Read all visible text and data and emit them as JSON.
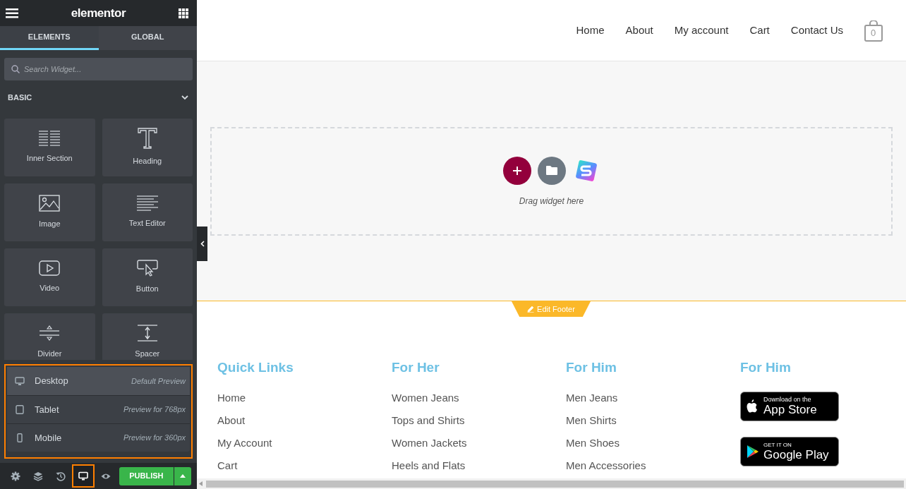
{
  "panel": {
    "title": "elementor",
    "tabs": [
      {
        "label": "ELEMENTS",
        "selected": true
      },
      {
        "label": "GLOBAL",
        "selected": false
      }
    ],
    "search": {
      "placeholder": "Search Widget..."
    },
    "category": {
      "label": "BASIC",
      "expanded": true
    },
    "widgets": [
      {
        "kind": "inner-section",
        "label": "Inner Section"
      },
      {
        "kind": "heading",
        "label": "Heading"
      },
      {
        "kind": "image",
        "label": "Image"
      },
      {
        "kind": "text-editor",
        "label": "Text Editor"
      },
      {
        "kind": "video",
        "label": "Video"
      },
      {
        "kind": "button",
        "label": "Button"
      },
      {
        "kind": "divider",
        "label": "Divider"
      },
      {
        "kind": "spacer",
        "label": "Spacer"
      }
    ],
    "devices": [
      {
        "kind": "desktop",
        "label": "Desktop",
        "hint": "Default Preview",
        "selected": true
      },
      {
        "kind": "tablet",
        "label": "Tablet",
        "hint": "Preview for 768px",
        "selected": false
      },
      {
        "kind": "mobile",
        "label": "Mobile",
        "hint": "Preview for 360px",
        "selected": false
      }
    ],
    "tools": [
      {
        "kind": "settings",
        "selected": false
      },
      {
        "kind": "navigator",
        "selected": false
      },
      {
        "kind": "history",
        "selected": false
      },
      {
        "kind": "responsive",
        "selected": true
      },
      {
        "kind": "preview",
        "selected": false
      }
    ],
    "publish": "PUBLISH"
  },
  "site": {
    "nav": [
      "Home",
      "About",
      "My account",
      "Cart",
      "Contact Us"
    ],
    "cart_count": "0",
    "drop_zone": {
      "hint": "Drag widget here"
    },
    "edit_footer": "Edit Footer",
    "footer_columns": [
      {
        "title": "Quick Links",
        "links": [
          "Home",
          "About",
          "My Account",
          "Cart"
        ]
      },
      {
        "title": "For Her",
        "links": [
          "Women Jeans",
          "Tops and Shirts",
          "Women Jackets",
          "Heels and Flats"
        ]
      },
      {
        "title": "For Him",
        "links": [
          "Men Jeans",
          "Men Shirts",
          "Men Shoes",
          "Men Accessories"
        ]
      },
      {
        "title": "For Him",
        "badges": [
          {
            "kind": "apple",
            "small": "Download on the",
            "big": "App Store"
          },
          {
            "kind": "google",
            "small": "GET IT ON",
            "big": "Google Play"
          }
        ]
      }
    ]
  }
}
